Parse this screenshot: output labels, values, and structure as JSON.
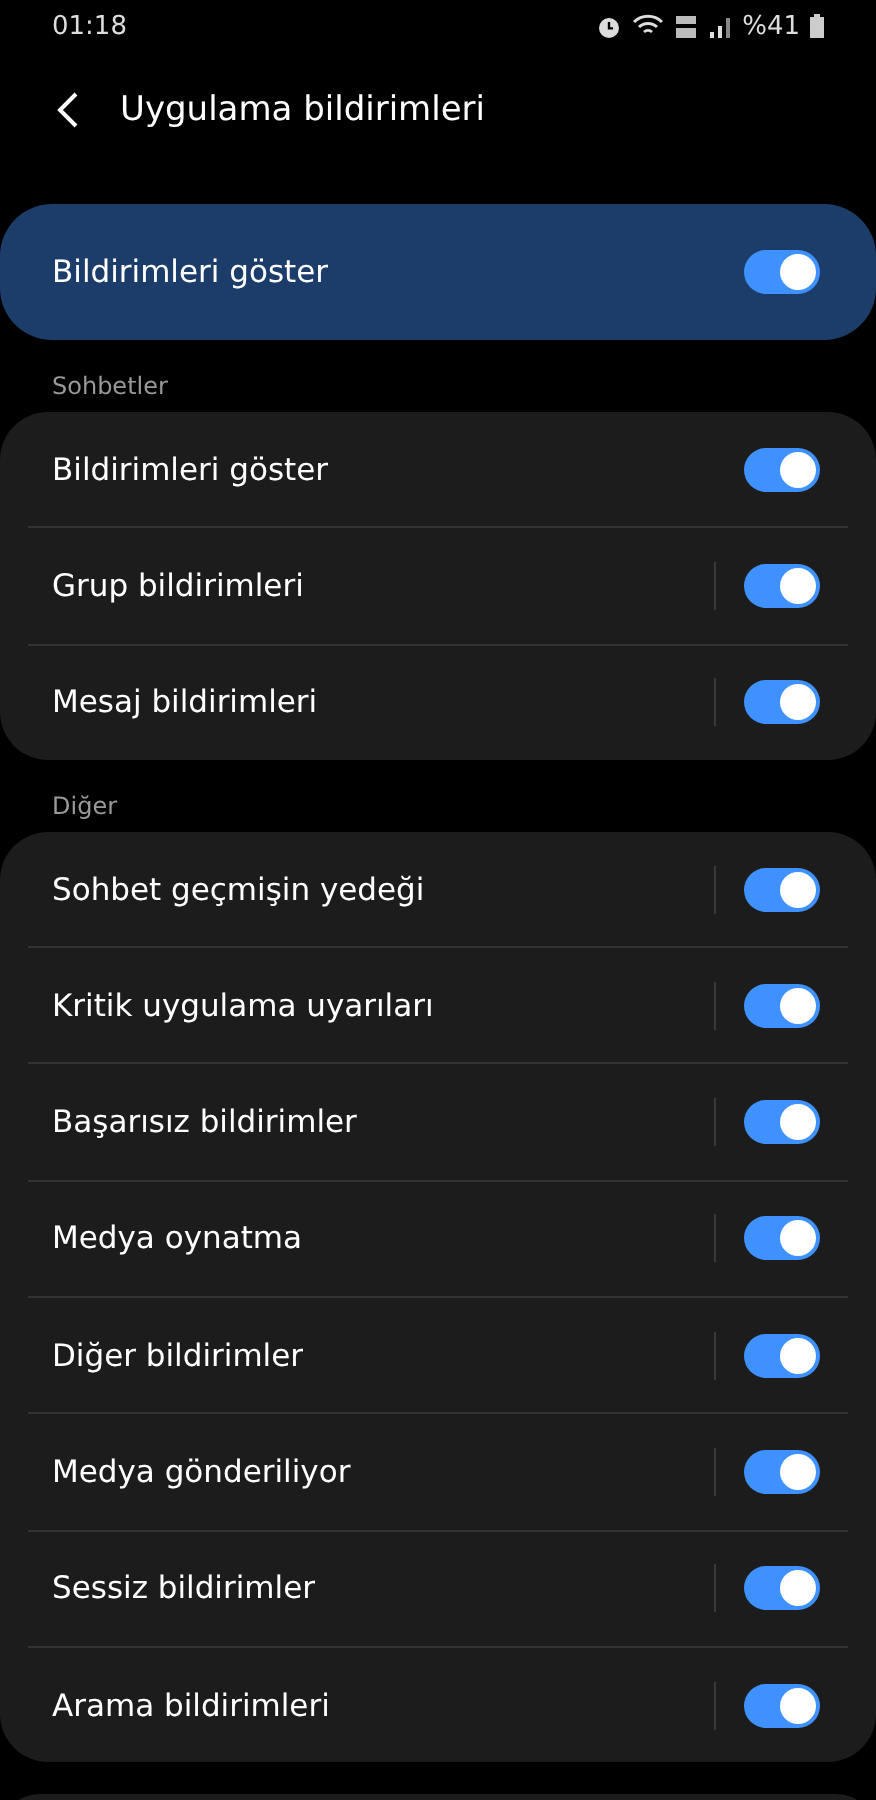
{
  "status_bar": {
    "time": "01:18",
    "battery_text": "%41"
  },
  "header": {
    "title": "Uygulama bildirimleri"
  },
  "master": {
    "label": "Bildirimleri göster",
    "on": true
  },
  "sections": [
    {
      "title": "Sohbetler",
      "items": [
        {
          "label": "Bildirimleri göster",
          "on": true,
          "divider": false
        },
        {
          "label": "Grup bildirimleri",
          "on": true,
          "divider": true
        },
        {
          "label": "Mesaj bildirimleri",
          "on": true,
          "divider": true
        }
      ]
    },
    {
      "title": "Diğer",
      "items": [
        {
          "label": "Sohbet geçmişin yedeği",
          "on": true,
          "divider": true
        },
        {
          "label": "Kritik uygulama uyarıları",
          "on": true,
          "divider": true
        },
        {
          "label": "Başarısız bildirimler",
          "on": true,
          "divider": true
        },
        {
          "label": "Medya oynatma",
          "on": true,
          "divider": true
        },
        {
          "label": "Diğer bildirimler",
          "on": true,
          "divider": true
        },
        {
          "label": "Medya gönderiliyor",
          "on": true,
          "divider": true
        },
        {
          "label": "Sessiz bildirimler",
          "on": true,
          "divider": true
        },
        {
          "label": "Arama bildirimleri",
          "on": true,
          "divider": true
        }
      ]
    }
  ]
}
